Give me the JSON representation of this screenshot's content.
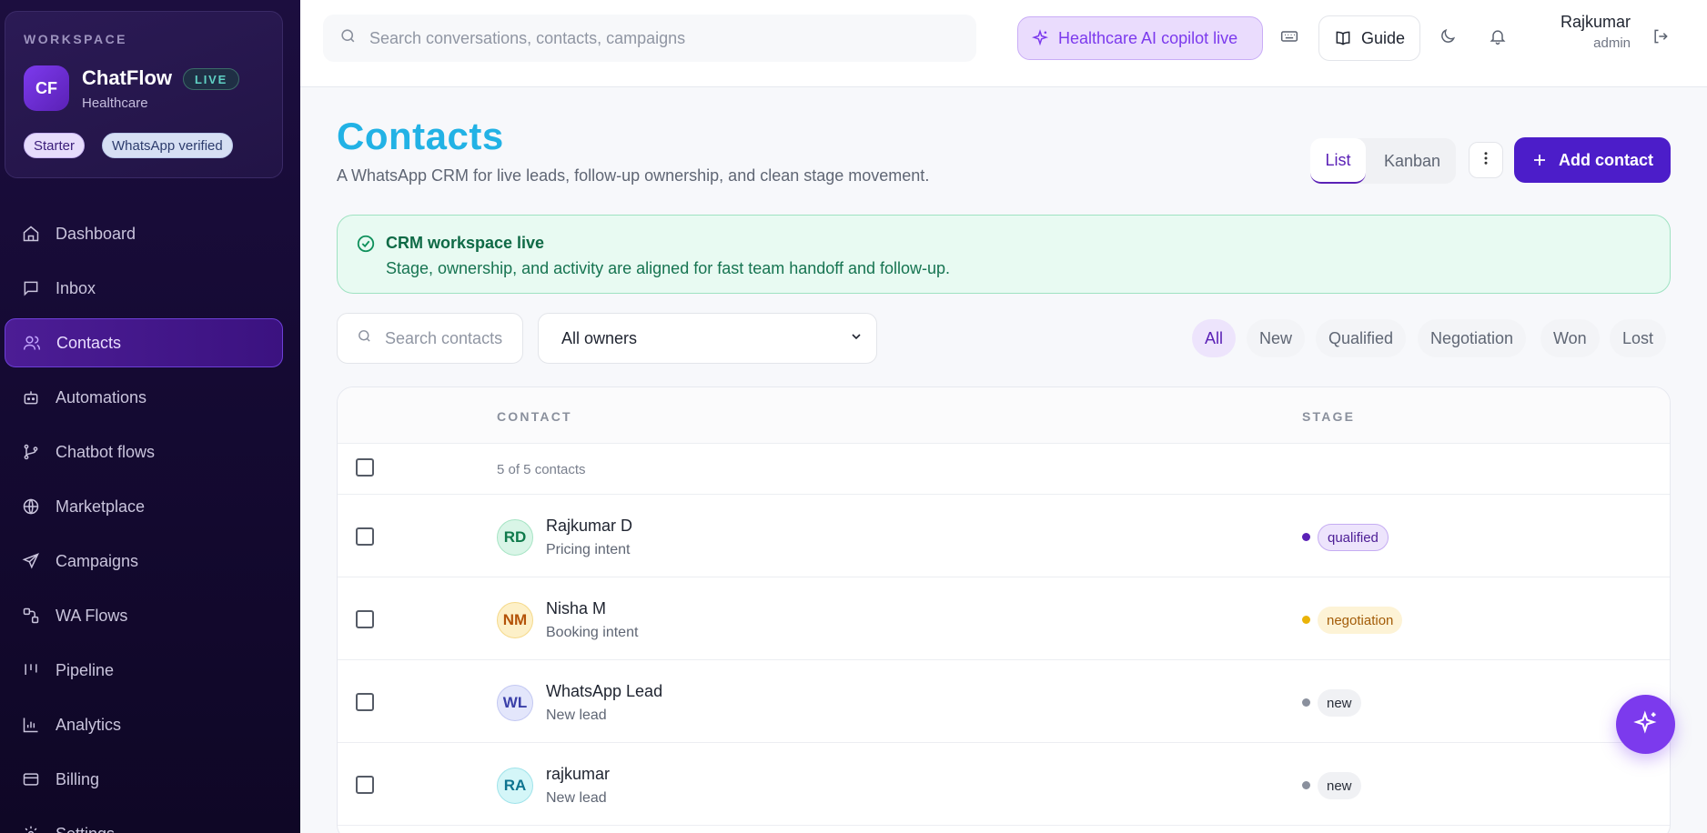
{
  "workspace": {
    "label": "WORKSPACE",
    "logo": "CF",
    "name": "ChatFlow",
    "live": "LIVE",
    "sub": "Healthcare",
    "chips": [
      "Starter",
      "WhatsApp verified"
    ]
  },
  "sidebar": {
    "items": [
      {
        "label": "Dashboard",
        "icon": "home-icon"
      },
      {
        "label": "Inbox",
        "icon": "message-icon"
      },
      {
        "label": "Contacts",
        "icon": "users-icon",
        "active": true
      },
      {
        "label": "Automations",
        "icon": "bot-icon"
      },
      {
        "label": "Chatbot flows",
        "icon": "flow-icon"
      },
      {
        "label": "Marketplace",
        "icon": "globe-icon"
      },
      {
        "label": "Campaigns",
        "icon": "send-icon"
      },
      {
        "label": "WA Flows",
        "icon": "workflow-icon"
      },
      {
        "label": "Pipeline",
        "icon": "kanban-icon"
      },
      {
        "label": "Analytics",
        "icon": "chart-icon"
      },
      {
        "label": "Billing",
        "icon": "card-icon"
      },
      {
        "label": "Settings",
        "icon": "gear-icon"
      }
    ]
  },
  "topbar": {
    "search_placeholder": "Search conversations, contacts, campaigns",
    "copilot": "Healthcare AI copilot live",
    "guide": "Guide",
    "user_name": "Rajkumar",
    "user_role": "admin"
  },
  "page": {
    "title": "Contacts",
    "subtitle": "A WhatsApp CRM for live leads, follow-up ownership, and clean stage movement.",
    "view_list": "List",
    "view_kanban": "Kanban",
    "add_contact": "Add contact"
  },
  "alert": {
    "title": "CRM workspace live",
    "text": "Stage, ownership, and activity are aligned for fast team handoff and follow-up."
  },
  "filters": {
    "search_placeholder": "Search contacts",
    "owner": "All owners",
    "stages": [
      "All",
      "New",
      "Qualified",
      "Negotiation",
      "Won",
      "Lost"
    ],
    "active_stage": "All"
  },
  "table": {
    "col_contact": "CONTACT",
    "col_stage": "STAGE",
    "summary": "5 of 5 contacts",
    "rows": [
      {
        "initials": "RD",
        "name": "Rajkumar D",
        "intent": "Pricing intent",
        "stage": "qualified"
      },
      {
        "initials": "NM",
        "name": "Nisha M",
        "intent": "Booking intent",
        "stage": "negotiation"
      },
      {
        "initials": "WL",
        "name": "WhatsApp Lead",
        "intent": "New lead",
        "stage": "new"
      },
      {
        "initials": "RA",
        "name": "rajkumar",
        "intent": "New lead",
        "stage": "new"
      }
    ]
  },
  "colors": {
    "accent": "#4c1dc9",
    "title": "#22b2e5",
    "sidebar_bg": "#150a33",
    "qualified": "#5b21b6",
    "negotiation": "#eab308",
    "new": "#8a909d"
  }
}
